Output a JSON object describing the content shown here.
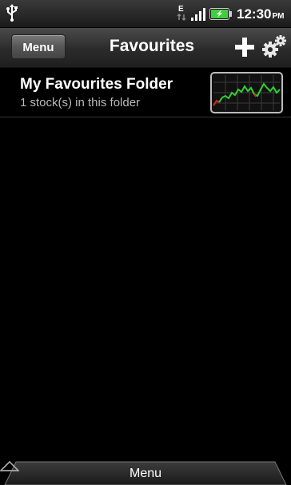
{
  "status_bar": {
    "network_type": "E",
    "time": "12:30",
    "ampm": "PM"
  },
  "header": {
    "menu_label": "Menu",
    "title": "Favourites"
  },
  "folders": [
    {
      "name": "My Favourites Folder",
      "count_text": "1 stock(s) in this folder"
    }
  ],
  "bottom_bar": {
    "menu_label": "Menu"
  },
  "colors": {
    "chart_line": "#2fd12f",
    "chart_line_down": "#e02020",
    "battery_fill": "#3ecf3e"
  },
  "icons": {
    "usb": "usb-icon",
    "add": "plus-icon",
    "settings": "gear-icon",
    "chart": "stock-chart-icon"
  }
}
